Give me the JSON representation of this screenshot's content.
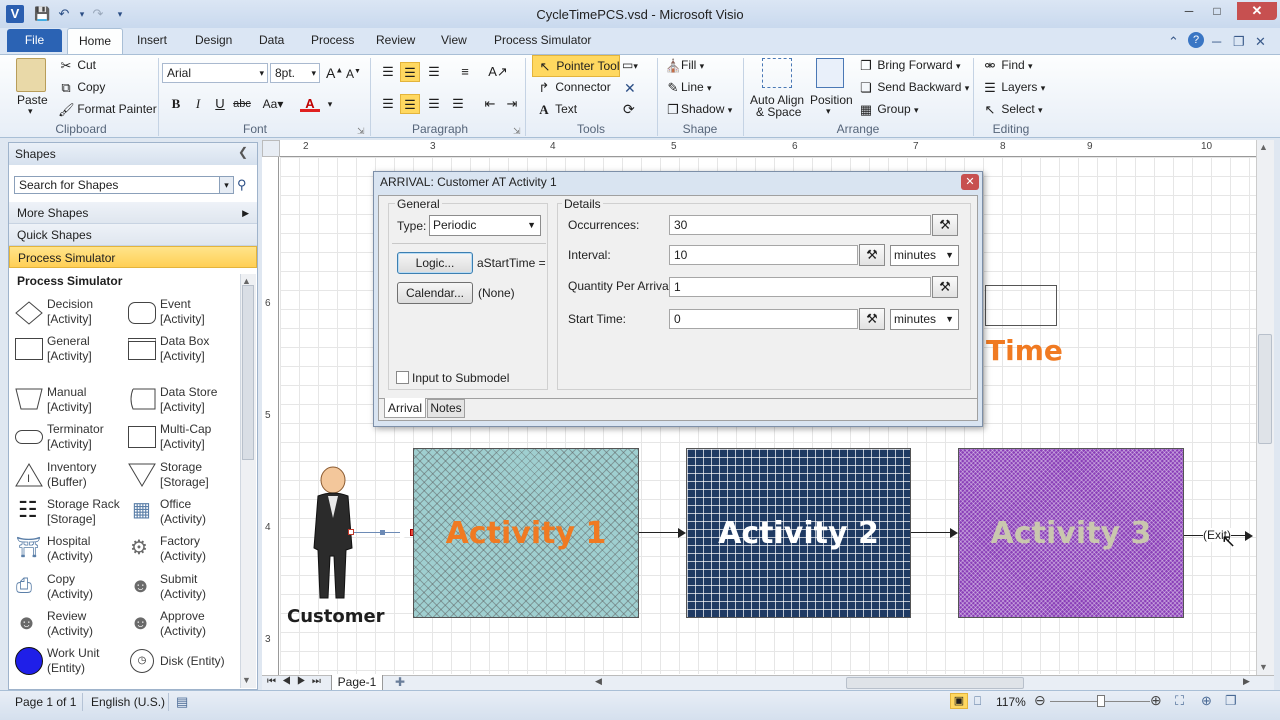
{
  "window": {
    "title": "CycleTimePCS.vsd - Microsoft Visio"
  },
  "tabs": {
    "file": "File",
    "home": "Home",
    "insert": "Insert",
    "design": "Design",
    "data": "Data",
    "process": "Process",
    "review": "Review",
    "view": "View",
    "process_simulator": "Process Simulator"
  },
  "ribbon": {
    "clipboard": {
      "paste": "Paste",
      "cut": "Cut",
      "copy": "Copy",
      "format_painter": "Format Painter",
      "label": "Clipboard"
    },
    "font": {
      "name": "Arial",
      "size": "8pt.",
      "label": "Font"
    },
    "paragraph": {
      "label": "Paragraph"
    },
    "tools": {
      "pointer": "Pointer Tool",
      "connector": "Connector",
      "text": "Text",
      "label": "Tools"
    },
    "shape": {
      "fill": "Fill",
      "line": "Line",
      "shadow": "Shadow",
      "label": "Shape"
    },
    "arrange": {
      "auto_align": "Auto Align",
      "space": "& Space",
      "position": "Position",
      "bring_forward": "Bring Forward",
      "send_backward": "Send Backward",
      "group": "Group",
      "label": "Arrange"
    },
    "editing": {
      "find": "Find",
      "layers": "Layers",
      "select": "Select",
      "label": "Editing"
    }
  },
  "shapes_panel": {
    "title": "Shapes",
    "search_placeholder": "Search for Shapes",
    "more_shapes": "More Shapes",
    "quick_shapes": "Quick Shapes",
    "process_simulator": "Process Simulator",
    "stencil_title": "Process Simulator",
    "items": [
      {
        "l1": "Decision",
        "l2": "[Activity]"
      },
      {
        "l1": "Event",
        "l2": "[Activity]"
      },
      {
        "l1": "General",
        "l2": "[Activity]"
      },
      {
        "l1": "Data Box",
        "l2": "[Activity]"
      },
      {
        "l1": "Manual",
        "l2": "[Activity]"
      },
      {
        "l1": "Data Store",
        "l2": "[Activity]"
      },
      {
        "l1": "Terminator",
        "l2": "[Activity]"
      },
      {
        "l1": "Multi-Cap",
        "l2": "[Activity]"
      },
      {
        "l1": "Inventory",
        "l2": "(Buffer)"
      },
      {
        "l1": "Storage",
        "l2": "[Storage]"
      },
      {
        "l1": "Storage Rack",
        "l2": "[Storage]"
      },
      {
        "l1": "Office",
        "l2": "(Activity)"
      },
      {
        "l1": "Hospital",
        "l2": "(Activity)"
      },
      {
        "l1": "Factory",
        "l2": "(Activity)"
      },
      {
        "l1": "Copy",
        "l2": "(Activity)"
      },
      {
        "l1": "Submit",
        "l2": "(Activity)"
      },
      {
        "l1": "Review",
        "l2": "(Activity)"
      },
      {
        "l1": "Approve",
        "l2": "(Activity)"
      },
      {
        "l1": "Work Unit",
        "l2": "(Entity)"
      },
      {
        "l1": "Disk (Entity)",
        "l2": ""
      }
    ]
  },
  "ruler": {
    "h": [
      "2",
      "3",
      "4",
      "5",
      "6",
      "7",
      "8",
      "9",
      "10"
    ],
    "v": [
      "6",
      "5",
      "4",
      "3"
    ]
  },
  "diagram": {
    "customer": "Customer",
    "activity1": "Activity 1",
    "activity2": "Activity 2",
    "activity3": "Activity 3",
    "exit": "(Exit)",
    "time_text": "Time"
  },
  "dialog": {
    "title": "ARRIVAL: Customer AT Activity 1",
    "general": "General",
    "type_label": "Type:",
    "type_value": "Periodic",
    "logic_button": "Logic...",
    "logic_text": "aStartTime =",
    "calendar_button": "Calendar...",
    "calendar_text": "(None)",
    "input_submodel": "Input to Submodel",
    "details": "Details",
    "occurrences_label": "Occurrences:",
    "occurrences_value": "30",
    "interval_label": "Interval:",
    "interval_value": "10",
    "interval_unit": "minutes",
    "qty_label": "Quantity Per Arrival:",
    "qty_value": "1",
    "start_label": "Start Time:",
    "start_value": "0",
    "start_unit": "minutes",
    "tab_arrival": "Arrival",
    "tab_notes": "Notes"
  },
  "pagebar": {
    "page": "Page-1"
  },
  "status": {
    "page": "Page 1 of 1",
    "language": "English (U.S.)",
    "zoom": "117%"
  },
  "colors": {
    "accent": "#2b63b4",
    "activity1_text": "#f07a22",
    "activity2_bg": "#1f3a63",
    "activity3_bg": "#8a3fb8",
    "time_box": "#f8c19f"
  }
}
